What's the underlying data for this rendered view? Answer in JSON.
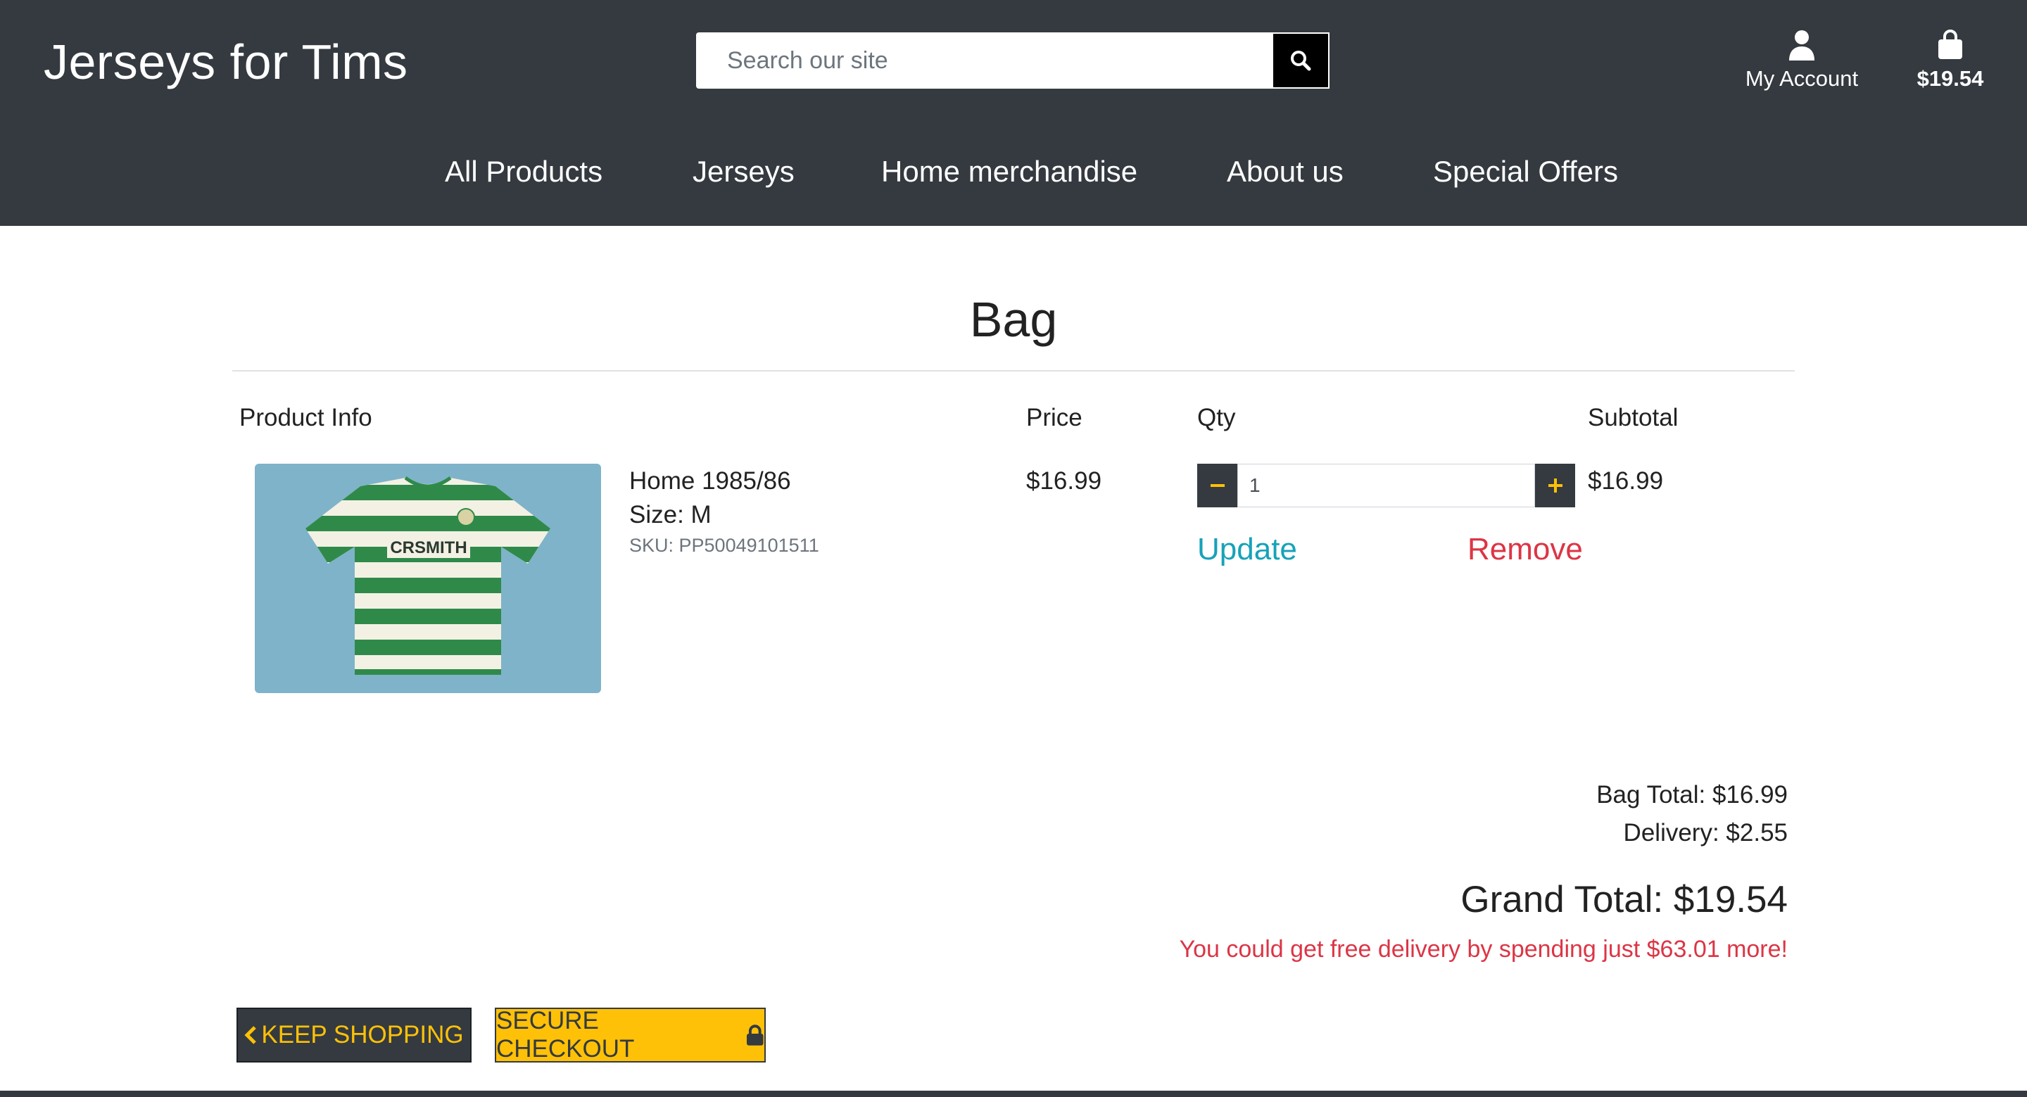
{
  "header": {
    "brand": "Jerseys for Tims",
    "search_placeholder": "Search our site",
    "account_label": "My Account",
    "bag_total": "$19.54"
  },
  "nav": {
    "items": [
      "All Products",
      "Jerseys",
      "Home merchandise",
      "About us",
      "Special Offers"
    ]
  },
  "page": {
    "title": "Bag"
  },
  "table": {
    "headers": {
      "product": "Product Info",
      "price": "Price",
      "qty": "Qty",
      "subtotal": "Subtotal"
    },
    "rows": [
      {
        "name": "Home 1985/86",
        "size_label": "Size:",
        "size": "M",
        "sku": "SKU: PP50049101511",
        "price": "$16.99",
        "qty": "1",
        "subtotal": "$16.99",
        "update_label": "Update",
        "remove_label": "Remove",
        "image_text": "CRSMITH"
      }
    ]
  },
  "summary": {
    "bag_total": "Bag Total: $16.99",
    "delivery": "Delivery: $2.55",
    "grand_total": "Grand Total: $19.54",
    "free_delivery": "You could get free delivery by spending just $63.01 more!"
  },
  "actions": {
    "keep_shopping": "KEEP SHOPPING",
    "secure_checkout": "SECURE CHECKOUT"
  },
  "colors": {
    "header_bg": "#343a40",
    "accent": "#ffc107",
    "update": "#17a2b8",
    "danger": "#dc3545"
  },
  "icons": {
    "search": "search-icon",
    "account": "user-icon",
    "bag": "shopping-bag-icon",
    "chevron": "chevron-left-icon",
    "lock": "lock-icon"
  }
}
